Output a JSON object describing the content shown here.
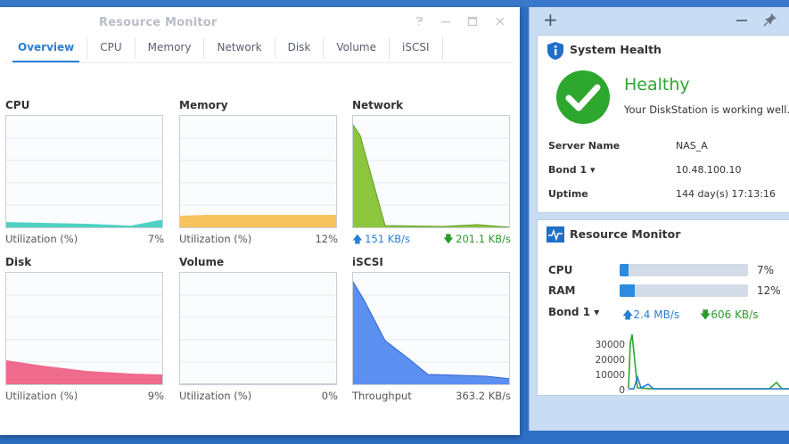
{
  "window": {
    "title": "Resource Monitor",
    "tabs": [
      "Overview",
      "CPU",
      "Memory",
      "Network",
      "Disk",
      "Volume",
      "iSCSI"
    ],
    "active_tab": "Overview"
  },
  "panels": {
    "cpu": {
      "title": "CPU",
      "foot_label": "Utilization (%)",
      "foot_value": "7%",
      "utilization_pct": 7,
      "color": "#4fd1c5"
    },
    "memory": {
      "title": "Memory",
      "foot_label": "Utilization (%)",
      "foot_value": "12%",
      "utilization_pct": 12,
      "color": "#f7c35f"
    },
    "network": {
      "title": "Network",
      "up_value": "151 KB/s",
      "down_value": "201.1 KB/s",
      "color": "#8cc63f"
    },
    "disk": {
      "title": "Disk",
      "foot_label": "Utilization (%)",
      "foot_value": "9%",
      "utilization_pct": 9,
      "color": "#ee6b8e"
    },
    "volume": {
      "title": "Volume",
      "foot_label": "Utilization (%)",
      "foot_value": "0%",
      "utilization_pct": 0
    },
    "iscsi": {
      "title": "iSCSI",
      "foot_label": "Throughput",
      "foot_value": "363.2 KB/s",
      "color": "#5b8ff0"
    }
  },
  "widgets": {
    "system_health": {
      "title": "System Health",
      "status": "Healthy",
      "description": "Your DiskStation is working well.",
      "rows": [
        {
          "label": "Server Name",
          "value": "NAS_A"
        },
        {
          "label": "Bond 1 ▾",
          "value": "10.48.100.10"
        },
        {
          "label": "Uptime",
          "value": "144 day(s) 17:13:16"
        }
      ]
    },
    "resource_monitor": {
      "title": "Resource Monitor",
      "cpu": {
        "label": "CPU",
        "value": "7%",
        "pct": 7
      },
      "ram": {
        "label": "RAM",
        "value": "12%",
        "pct": 12
      },
      "network": {
        "label": "Bond 1 ▾",
        "up": "2.4 MB/s",
        "down": "606 KB/s"
      },
      "chart_ticks": [
        "30000",
        "20000",
        "10000",
        "0"
      ]
    }
  },
  "colors": {
    "accent": "#2a7fd4",
    "healthy": "#2ea72e",
    "up": "#2a7fd4",
    "down": "#2b9a2b"
  }
}
